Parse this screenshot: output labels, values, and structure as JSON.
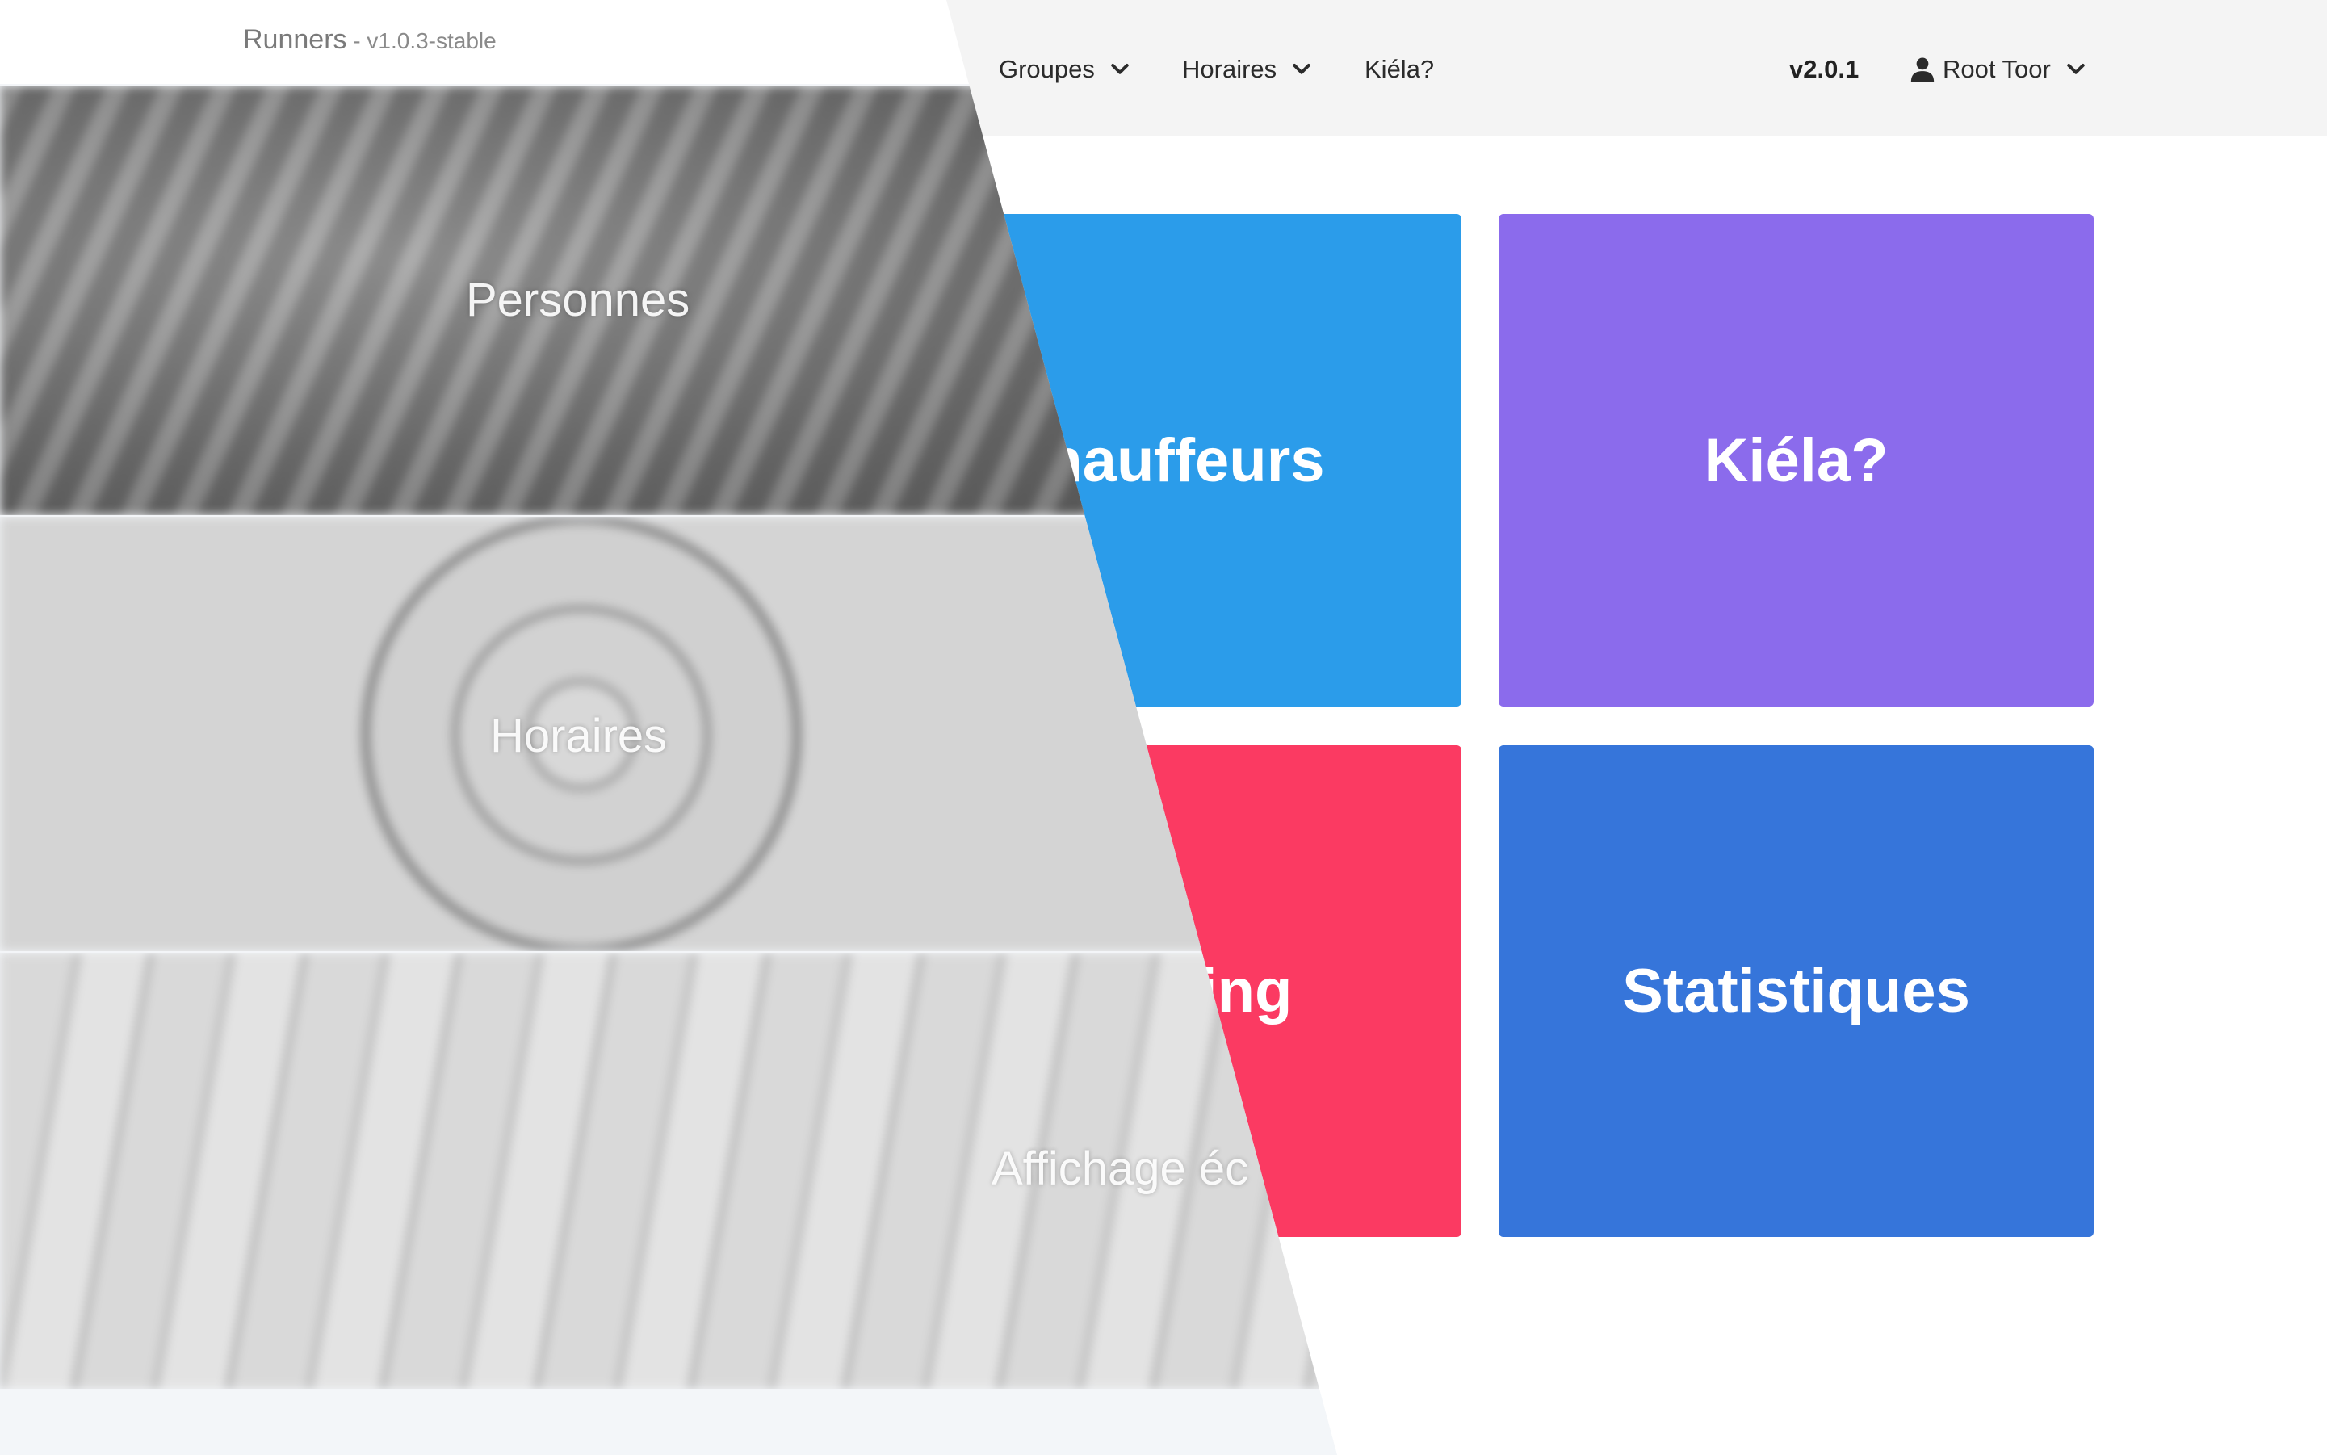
{
  "old_version": {
    "brand": "Runners",
    "version": " - v1.0.3-stable",
    "panels": [
      {
        "label": "Personnes"
      },
      {
        "label": "Horaires"
      },
      {
        "label": "Affichage éc"
      }
    ]
  },
  "new_version": {
    "nav": {
      "groupes": "Groupes",
      "horaires": "Horaires",
      "kiela": "Kiéla?",
      "version": "v2.0.1",
      "user": "Root Toor"
    },
    "tiles": [
      {
        "label": "Chauffeurs",
        "color": "#2b9cea"
      },
      {
        "label": "Kiéla?",
        "color": "#8b6bec"
      },
      {
        "label": "Planning",
        "color": "#fb3a62"
      },
      {
        "label": "Statistiques",
        "color": "#3675da"
      }
    ]
  },
  "icons": [
    "chevron-down-icon",
    "user-icon"
  ]
}
